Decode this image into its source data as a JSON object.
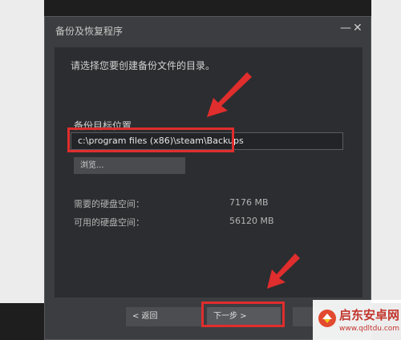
{
  "window": {
    "title": "备份及恢复程序",
    "minimize": "—",
    "close": "✕"
  },
  "content": {
    "instruction": "请选择您要创建备份文件的目录。",
    "folder_label": "备份目标位置",
    "path_value": "c:\\program files (x86)\\steam\\Backups",
    "browse_label": "浏览...",
    "space": [
      {
        "label": "需要的硬盘空间：",
        "value": "7176 MB"
      },
      {
        "label": "可用的硬盘空间：",
        "value": "56120 MB"
      }
    ]
  },
  "footer": {
    "back_label": "< 返回",
    "next_label": "下一步 >",
    "cancel_label": ""
  },
  "watermark": {
    "line1": "启东安卓网",
    "line2": "www.qdltdu.com"
  },
  "colors": {
    "highlight": "#e02d2d",
    "dialog_bg": "#3c3d40",
    "panel_bg": "#2c2d30"
  },
  "icons": {
    "minimize": "minimize-icon",
    "close": "close-icon",
    "arrow": "red-arrow-icon",
    "logo": "watermark-logo-icon"
  }
}
